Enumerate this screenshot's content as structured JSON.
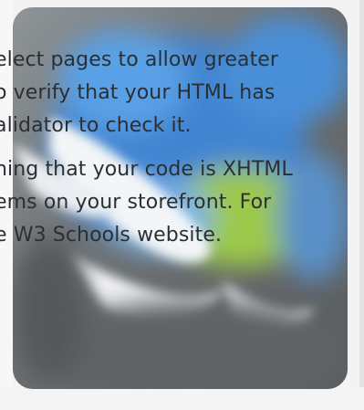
{
  "paragraphs": [
    {
      "lines": [
        "elect pages to allow greater",
        "o verify that your HTML has",
        "alidator to check it."
      ]
    },
    {
      "lines": [
        "ning that your code is XHTML",
        "ems on your storefront. For",
        "e W3 Schools website."
      ]
    }
  ],
  "background_image": "blurred-browser-logo",
  "colors": {
    "text": "#2b2f33",
    "panel_blue": "#3f86d6",
    "panel_green": "#8fbf3c",
    "panel_gray": "#5d6062"
  }
}
